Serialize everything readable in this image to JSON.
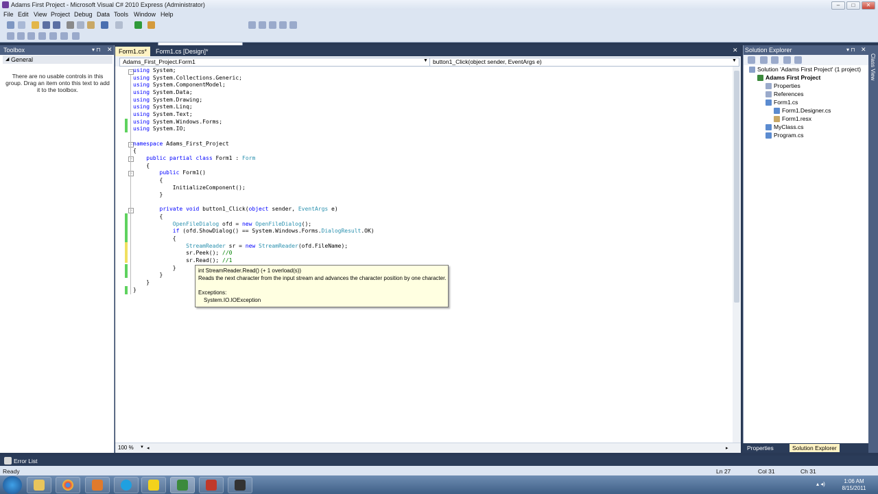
{
  "window": {
    "title": "Adams First Project - Microsoft Visual C# 2010 Express (Administrator)"
  },
  "menu": [
    "File",
    "Edit",
    "View",
    "Project",
    "Debug",
    "Data",
    "Tools",
    "Window",
    "Help"
  ],
  "toolbox": {
    "title": "Toolbox",
    "group": "General",
    "message": "There are no usable controls in this group. Drag an item onto this text to add it to the toolbox."
  },
  "editor": {
    "tabs": [
      {
        "label": "Form1.cs*",
        "active": true
      },
      {
        "label": "Form1.cs [Design]*",
        "active": false
      }
    ],
    "class_nav": "Adams_First_Project.Form1",
    "member_nav": "button1_Click(object sender, EventArgs e)",
    "zoom": "100 %",
    "lines": [
      "using System;",
      "using System.Collections.Generic;",
      "using System.ComponentModel;",
      "using System.Data;",
      "using System.Drawing;",
      "using System.Linq;",
      "using System.Text;",
      "using System.Windows.Forms;",
      "using System.IO;",
      "",
      "namespace Adams_First_Project",
      "{",
      "    public partial class Form1 : Form",
      "    {",
      "        public Form1()",
      "        {",
      "            InitializeComponent();",
      "        }",
      "",
      "        private void button1_Click(object sender, EventArgs e)",
      "        {",
      "            OpenFileDialog ofd = new OpenFileDialog();",
      "            if (ofd.ShowDialog() == System.Windows.Forms.DialogResult.OK)",
      "            {",
      "                StreamReader sr = new StreamReader(ofd.FileName);",
      "                sr.Peek(); //0",
      "                sr.Read(); //1",
      "            }",
      "        }",
      "    }",
      "}"
    ]
  },
  "tooltip": {
    "signature": "int StreamReader.Read()  (+ 1 overload(s))",
    "description": "Reads the next character from the input stream and advances the character position by one character.",
    "exceptions_label": "Exceptions:",
    "exception": "System.IO.IOException"
  },
  "solution_explorer": {
    "title": "Solution Explorer",
    "items": [
      {
        "label": "Solution 'Adams First Project' (1 project)",
        "indent": 0,
        "bold": false
      },
      {
        "label": "Adams First Project",
        "indent": 1,
        "bold": true
      },
      {
        "label": "Properties",
        "indent": 2,
        "bold": false
      },
      {
        "label": "References",
        "indent": 2,
        "bold": false
      },
      {
        "label": "Form1.cs",
        "indent": 2,
        "bold": false
      },
      {
        "label": "Form1.Designer.cs",
        "indent": 3,
        "bold": false
      },
      {
        "label": "Form1.resx",
        "indent": 3,
        "bold": false
      },
      {
        "label": "MyClass.cs",
        "indent": 2,
        "bold": false
      },
      {
        "label": "Program.cs",
        "indent": 2,
        "bold": false
      }
    ],
    "bottom_tabs": [
      "Properties",
      "Solution Explorer"
    ],
    "side_tab": "Class View"
  },
  "error_list": {
    "label": "Error List"
  },
  "status": {
    "ready": "Ready",
    "line": "Ln 27",
    "col": "Col 31",
    "ch": "Ch 31"
  },
  "clock": {
    "time": "1:06 AM",
    "date": "8/15/2011"
  },
  "colors": {
    "keyword": "#0000ff",
    "type": "#2b91af",
    "comment": "#008000",
    "chrome": "#293955"
  }
}
